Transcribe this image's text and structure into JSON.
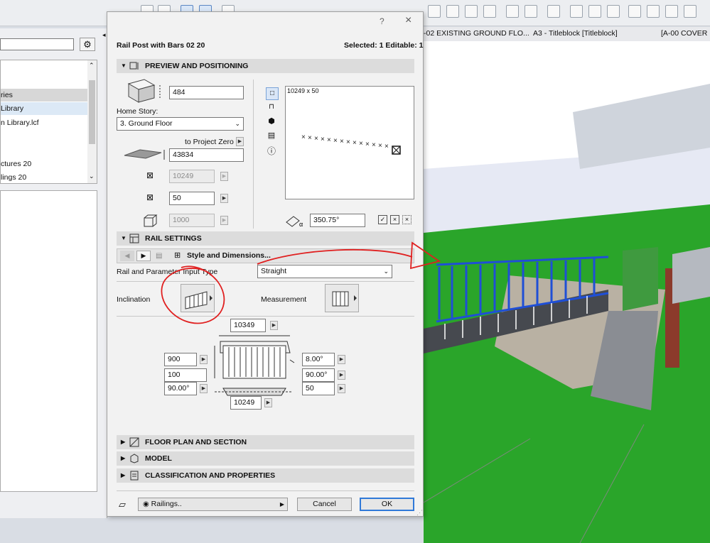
{
  "background": {
    "tabs": [
      "-02 EXISTING GROUND FLO...",
      "A3 - Titleblock [Titleblock]",
      "[A-00 COVER"
    ],
    "tree_items": [
      "ries",
      "Library",
      "n Library.lcf",
      "ctures 20",
      "lings 20"
    ]
  },
  "dialog": {
    "help": "?",
    "close": "×",
    "title": "Rail Post with Bars 02 20",
    "selected_info": "Selected: 1 Editable: 1",
    "sections": {
      "preview": "PREVIEW AND POSITIONING",
      "rail": "RAIL SETTINGS",
      "floor_plan": "FLOOR PLAN AND SECTION",
      "model": "MODEL",
      "classification": "CLASSIFICATION AND PROPERTIES"
    },
    "positioning": {
      "height_value": "484",
      "home_story_label": "Home Story:",
      "home_story_value": "3. Ground Floor",
      "to_project_zero": "to Project Zero",
      "elevation_value": "43834",
      "length_value": "10249",
      "width_value": "50",
      "depth_value": "1000",
      "preview_caption": "10249 x 50",
      "angle_value": "350.75°"
    },
    "rail_settings": {
      "page_label": "Style and Dimensions...",
      "input_type_label": "Rail and Parameter Input Type",
      "input_type_value": "Straight",
      "inclination_label": "Inclination",
      "measurement_label": "Measurement",
      "top_length": "10349",
      "left_height": "900",
      "left_offset": "100",
      "left_angle": "90.00°",
      "right_angle1": "8.00°",
      "right_angle2": "90.00°",
      "right_value": "50",
      "bottom_length": "10249"
    },
    "footer": {
      "railings_label": "Railings..",
      "cancel_label": "Cancel",
      "ok_label": "OK"
    }
  },
  "colors": {
    "selection_blue": "#1f4fd6",
    "grass_green": "#2aa52a",
    "annotation_red": "#e02020",
    "ok_border": "#3079d8"
  }
}
